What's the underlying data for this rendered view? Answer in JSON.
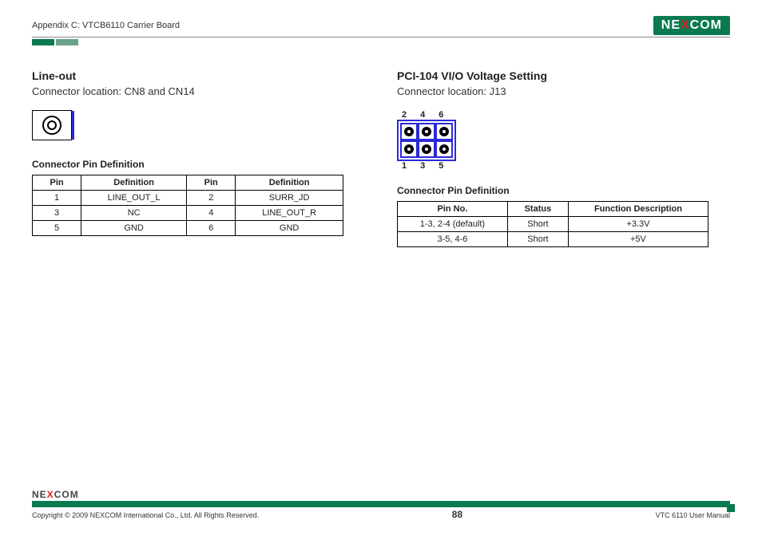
{
  "header": {
    "appendix": "Appendix C: VTCB6110 Carrier Board",
    "logo_ne": "NE",
    "logo_x": "X",
    "logo_com": "COM"
  },
  "left": {
    "title": "Line-out",
    "sub": "Connector location: CN8 and CN14",
    "table_caption": "Connector Pin Definition",
    "headers": {
      "pin": "Pin",
      "def": "Definition"
    },
    "rows": [
      {
        "p1": "1",
        "d1": "LINE_OUT_L",
        "p2": "2",
        "d2": "SURR_JD"
      },
      {
        "p1": "3",
        "d1": "NC",
        "p2": "4",
        "d2": "LINE_OUT_R"
      },
      {
        "p1": "5",
        "d1": "GND",
        "p2": "6",
        "d2": "GND"
      }
    ]
  },
  "right": {
    "title": "PCI-104 VI/O Voltage Setting",
    "sub": "Connector location: J13",
    "top_labels": [
      "2",
      "4",
      "6"
    ],
    "bot_labels": [
      "1",
      "3",
      "5"
    ],
    "table_caption": "Connector Pin Definition",
    "headers": {
      "pinno": "Pin No.",
      "status": "Status",
      "func": "Function Description"
    },
    "rows": [
      {
        "pinno": "1-3, 2-4 (default)",
        "status": "Short",
        "func": "+3.3V"
      },
      {
        "pinno": "3-5, 4-6",
        "status": "Short",
        "func": "+5V"
      }
    ]
  },
  "footer": {
    "logo_ne": "NE",
    "logo_x": "X",
    "logo_com": "COM",
    "copyright": "Copyright © 2009 NEXCOM International Co., Ltd. All Rights Reserved.",
    "page": "88",
    "manual": "VTC 6110 User Manual"
  }
}
